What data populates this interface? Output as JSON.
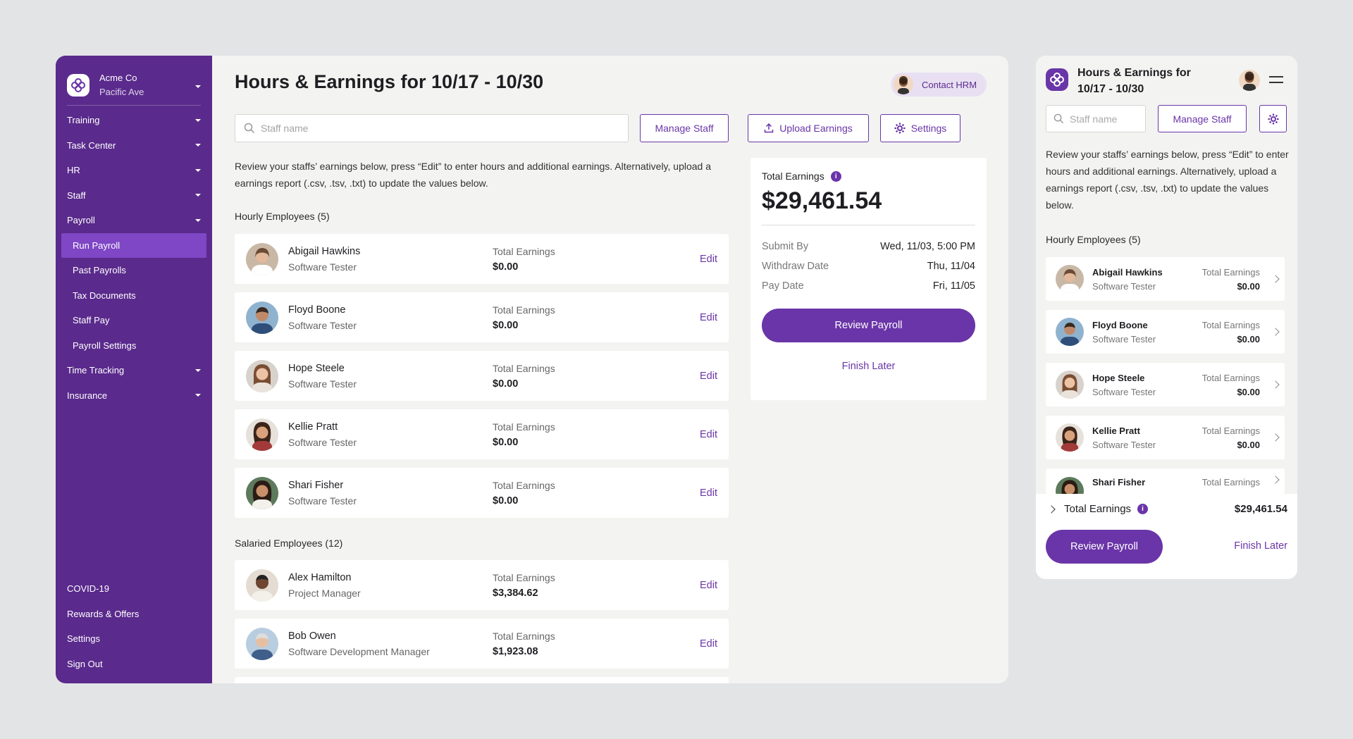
{
  "company": {
    "name": "Acme Co",
    "location": "Pacific Ave"
  },
  "sidebar": {
    "items": [
      {
        "label": "Training"
      },
      {
        "label": "Task Center"
      },
      {
        "label": "HR"
      },
      {
        "label": "Staff"
      },
      {
        "label": "Payroll"
      },
      {
        "label": "Run Payroll"
      },
      {
        "label": "Past Payrolls"
      },
      {
        "label": "Tax Documents"
      },
      {
        "label": "Staff Pay"
      },
      {
        "label": "Payroll Settings"
      },
      {
        "label": "Time Tracking"
      },
      {
        "label": "Insurance"
      }
    ],
    "bottom": [
      {
        "label": "COVID-19"
      },
      {
        "label": "Rewards & Offers"
      },
      {
        "label": "Settings"
      },
      {
        "label": "Sign Out"
      }
    ]
  },
  "header": {
    "title": "Hours & Earnings for 10/17 - 10/30",
    "contact_label": "Contact HRM"
  },
  "toolbar": {
    "search_placeholder": "Staff name",
    "manage_staff": "Manage Staff",
    "upload_earnings": "Upload Earnings",
    "settings": "Settings"
  },
  "description": "Review your staffs’ earnings below, press “Edit” to enter hours and additional earnings. Alternatively, upload a earnings report (.csv, .tsv, .txt) to update the values below.",
  "hourly": {
    "label": "Hourly Employees (5)",
    "employees": [
      {
        "name": "Abigail Hawkins",
        "role": "Software Tester",
        "earnings_label": "Total Earnings",
        "earnings": "$0.00",
        "edit": "Edit"
      },
      {
        "name": "Floyd Boone",
        "role": "Software Tester",
        "earnings_label": "Total Earnings",
        "earnings": "$0.00",
        "edit": "Edit"
      },
      {
        "name": "Hope Steele",
        "role": "Software Tester",
        "earnings_label": "Total Earnings",
        "earnings": "$0.00",
        "edit": "Edit"
      },
      {
        "name": "Kellie Pratt",
        "role": "Software Tester",
        "earnings_label": "Total Earnings",
        "earnings": "$0.00",
        "edit": "Edit"
      },
      {
        "name": "Shari Fisher",
        "role": "Software Tester",
        "earnings_label": "Total Earnings",
        "earnings": "$0.00",
        "edit": "Edit"
      }
    ]
  },
  "salaried": {
    "label": "Salaried Employees (12)",
    "employees": [
      {
        "name": "Alex Hamilton",
        "role": "Project Manager",
        "earnings_label": "Total Earnings",
        "earnings": "$3,384.62",
        "edit": "Edit"
      },
      {
        "name": "Bob Owen",
        "role": "Software Development Manager",
        "earnings_label": "Total Earnings",
        "earnings": "$1,923.08",
        "edit": "Edit"
      }
    ]
  },
  "summary": {
    "label": "Total Earnings",
    "total": "$29,461.54",
    "rows": [
      {
        "key": "Submit By",
        "value": "Wed, 11/03, 5:00 PM"
      },
      {
        "key": "Withdraw Date",
        "value": "Thu, 11/04"
      },
      {
        "key": "Pay Date",
        "value": "Fri, 11/05"
      }
    ],
    "review_button": "Review Payroll",
    "finish_later": "Finish Later"
  },
  "mobile": {
    "title": "Hours & Earnings for 10/17 - 10/30",
    "search_placeholder": "Staff name",
    "manage_staff": "Manage Staff",
    "description": "Review your staffs’ earnings below, press “Edit” to enter hours and additional earnings. Alternatively, upload a earnings report (.csv, .tsv, .txt) to update the values below.",
    "hourly_label": "Hourly Employees (5)",
    "employees": [
      {
        "name": "Abigail Hawkins",
        "role": "Software Tester",
        "earnings_label": "Total Earnings",
        "earnings": "$0.00"
      },
      {
        "name": "Floyd Boone",
        "role": "Software Tester",
        "earnings_label": "Total Earnings",
        "earnings": "$0.00"
      },
      {
        "name": "Hope Steele",
        "role": "Software Tester",
        "earnings_label": "Total Earnings",
        "earnings": "$0.00"
      },
      {
        "name": "Kellie Pratt",
        "role": "Software Tester",
        "earnings_label": "Total Earnings",
        "earnings": "$0.00"
      },
      {
        "name": "Shari Fisher",
        "role": "",
        "earnings_label": "Total Earnings",
        "earnings": ""
      }
    ],
    "total_label": "Total Earnings",
    "total": "$29,461.54",
    "review_button": "Review Payroll",
    "finish_later": "Finish Later"
  },
  "colors": {
    "brand": "#5a2a8c",
    "accent": "#6a35a8",
    "active_nav": "#7f46c6",
    "background": "#e3e4e6"
  }
}
